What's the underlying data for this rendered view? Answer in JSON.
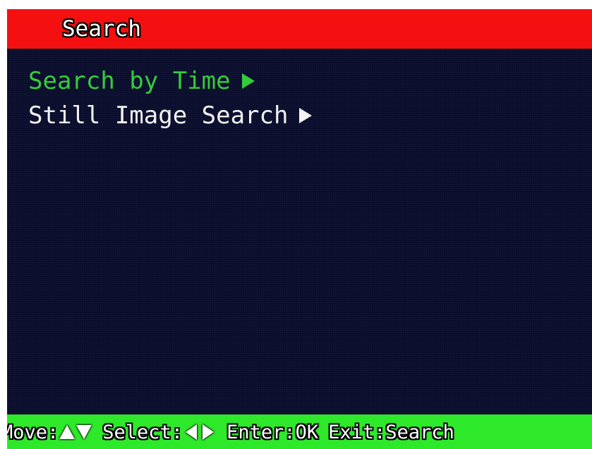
{
  "title_bar": {
    "title": "Search",
    "color": "#f41010"
  },
  "menu": {
    "items": [
      {
        "label": "Search by Time",
        "selected": true,
        "color": "#34cc3c",
        "icon": "play-arrow-icon"
      },
      {
        "label": "Still Image Search",
        "selected": false,
        "color": "#f2f2f2",
        "icon": "play-arrow-icon"
      }
    ]
  },
  "footer": {
    "color": "#2ee82a",
    "move_label": "Move:",
    "move_icons": [
      "up-arrow-icon",
      "down-arrow-icon"
    ],
    "select_label": "Select:",
    "select_icons": [
      "left-arrow-icon",
      "right-arrow-icon"
    ],
    "enter_text": "Enter:OK",
    "exit_text": "Exit:Search"
  },
  "colors": {
    "background": "#0a0c2c"
  }
}
